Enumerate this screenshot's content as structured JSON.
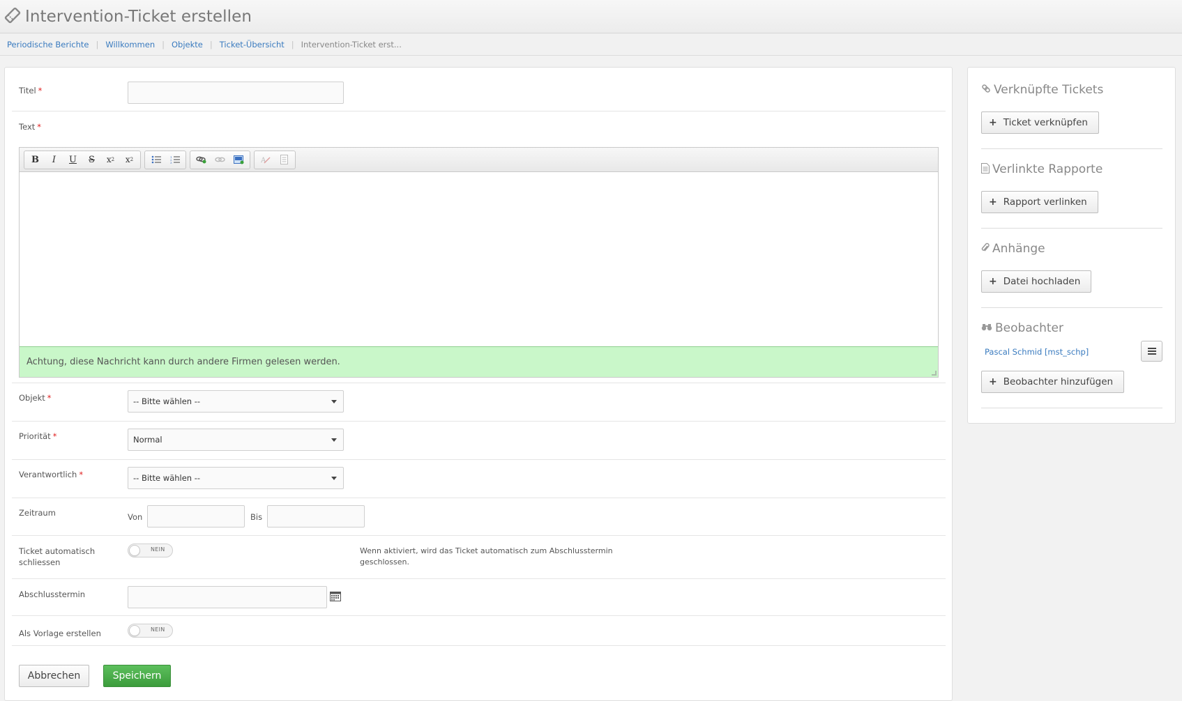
{
  "header": {
    "title": "Intervention-Ticket erstellen",
    "icon": "ticket-icon"
  },
  "breadcrumb": {
    "items": [
      "Periodische Berichte",
      "Willkommen",
      "Objekte",
      "Ticket-Übersicht"
    ],
    "current": "Intervention-Ticket erst...",
    "separator": "|"
  },
  "form": {
    "title_label": "Titel",
    "title_value": "",
    "text_label": "Text",
    "editor": {
      "toolbar": [
        "bold",
        "italic",
        "underline",
        "strikethrough",
        "subscript",
        "superscript",
        "bulleted-list",
        "numbered-list",
        "insert-link",
        "remove-link",
        "insert-image",
        "remove-format",
        "paste-text"
      ],
      "notice": "Achtung, diese Nachricht kann durch andere Firmen gelesen werden."
    },
    "required_mark": "*",
    "object_label": "Objekt",
    "object_value": "-- Bitte wählen --",
    "priority_label": "Priorität",
    "priority_value": "Normal",
    "responsible_label": "Verantwortlich",
    "responsible_value": "-- Bitte wählen --",
    "period_label": "Zeitraum",
    "period_from_label": "Von",
    "period_to_label": "Bis",
    "auto_close_label_1": "Ticket automatisch",
    "auto_close_label_2": "schliessen",
    "auto_close_toggle": "NEIN",
    "auto_close_help_1": "Wenn aktiviert, wird das Ticket automatisch zum Abschlusstermin",
    "auto_close_help_2": "geschlossen.",
    "closing_date_label": "Abschlusstermin",
    "template_label": "Als Vorlage erstellen",
    "template_toggle": "NEIN",
    "cancel_label": "Abbrechen",
    "save_label": "Speichern",
    "colors": {
      "save": "#4cae4c",
      "notice_bg": "#c9f7c9",
      "link": "#3a7bbf",
      "required": "#e02020"
    }
  },
  "sidebar": {
    "linked_tickets_title": "Verknüpfte Tickets",
    "link_ticket_button": "Ticket verknüpfen",
    "linked_reports_title": "Verlinkte Rapporte",
    "link_report_button": "Rapport verlinken",
    "attachments_title": "Anhänge",
    "upload_button": "Datei hochladen",
    "observers_title": "Beobachter",
    "observer_name": "Pascal Schmid [mst_schp]",
    "add_observer_button": "Beobachter hinzufügen"
  }
}
